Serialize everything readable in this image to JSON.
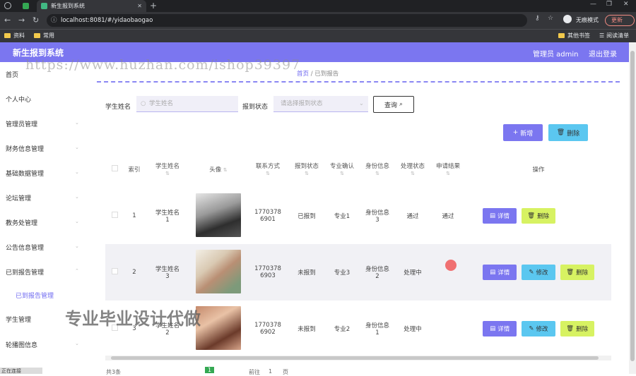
{
  "browser": {
    "tab_title": "新生报到系统",
    "url": "localhost:8081/#/yidaobaogao",
    "incognito_label": "无痕模式",
    "update_label": "更新",
    "bookmarks": [
      "资料",
      "常用"
    ],
    "other_bookmarks": "其他书签",
    "reading_list": "阅读清单"
  },
  "header": {
    "title": "新生报到系统",
    "user": "管理员 admin",
    "logout": "退出登录"
  },
  "sidebar": {
    "items": [
      "首页",
      "个人中心",
      "管理员管理",
      "财务信息管理",
      "基础数据管理",
      "论坛管理",
      "教务处管理",
      "公告信息管理",
      "已到报告管理",
      "已到报告管理",
      "学生管理",
      "轮播图信息"
    ]
  },
  "breadcrumb": {
    "home": "首页",
    "current": "已到报告"
  },
  "watermark": "https://www.huzhan.com/ishop39397",
  "overlay_text": "专业毕业设计代做",
  "search": {
    "name_label": "学生姓名",
    "name_placeholder": "学生姓名",
    "status_label": "报到状态",
    "status_placeholder": "请选择报到状态",
    "query_button": "查询"
  },
  "actions": {
    "add": "新增",
    "delete": "删除"
  },
  "table": {
    "headers": [
      "索引",
      "学生姓名",
      "头像",
      "联系方式",
      "报到状态",
      "专业确认",
      "身份信息",
      "处理状态",
      "申请结果",
      "操作"
    ],
    "rows": [
      {
        "index": "1",
        "name_line1": "学生姓名",
        "name_line2": "1",
        "phone_line1": "1770",
        "phone_line2": "378",
        "phone_line3": "6901",
        "report": "已报到",
        "major": "专业1",
        "id_line1": "身份信息",
        "id_line2": "3",
        "process": "通过",
        "result": "通过"
      },
      {
        "index": "2",
        "name_line1": "学生姓名",
        "name_line2": "3",
        "phone_line1": "1770",
        "phone_line2": "378",
        "phone_line3": "6903",
        "report": "未报到",
        "major": "专业3",
        "id_line1": "身份信息",
        "id_line2": "2",
        "process": "处理中",
        "result": ""
      },
      {
        "index": "3",
        "name_line1": "学生姓名",
        "name_line2": "2",
        "phone_line1": "1770",
        "phone_line2": "378",
        "phone_line3": "6902",
        "report": "未报到",
        "major": "专业2",
        "id_line1": "身份信息",
        "id_line2": "1",
        "process": "处理中",
        "result": ""
      }
    ],
    "btn_detail": "详情",
    "btn_edit": "修改",
    "btn_delete": "删除"
  },
  "pagination": {
    "prefix": "共3条",
    "page": "1",
    "goto": "前往",
    "unit": "页"
  },
  "status_bar": "正在连接"
}
